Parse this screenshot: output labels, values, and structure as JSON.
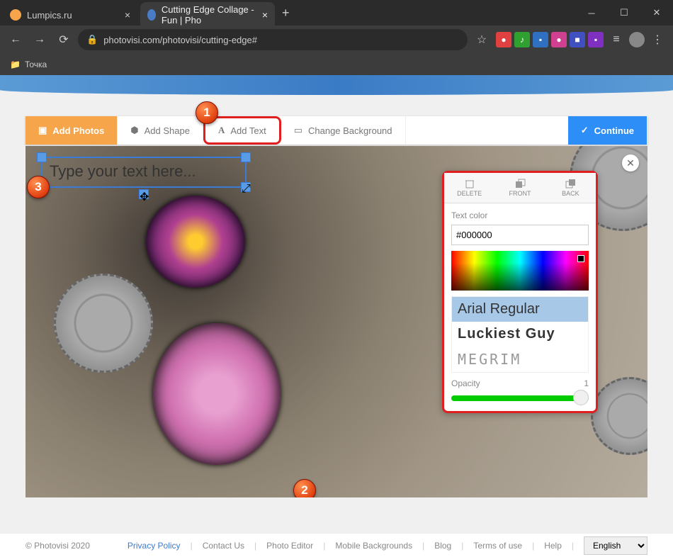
{
  "browser": {
    "tabs": [
      {
        "title": "Lumpics.ru",
        "active": false
      },
      {
        "title": "Cutting Edge Collage - Fun | Pho",
        "active": true
      }
    ],
    "url": "photovisi.com/photovisi/cutting-edge#",
    "bookmark": {
      "label": "Точка"
    }
  },
  "toolbar": {
    "add_photos": "Add Photos",
    "add_shape": "Add Shape",
    "add_text": "Add Text",
    "change_bg": "Change Background",
    "continue": "Continue"
  },
  "canvas": {
    "text_placeholder": "Type your text here..."
  },
  "panel": {
    "delete": "DELETE",
    "front": "FRONT",
    "back": "BACK",
    "text_color_label": "Text color",
    "color_value": "#000000",
    "fonts": [
      "Arial Regular",
      "Luckiest Guy",
      "MEGRIM"
    ],
    "opacity_label": "Opacity",
    "opacity_value": "1"
  },
  "footer": {
    "copyright": "© Photovisi 2020",
    "links": [
      "Privacy Policy",
      "Contact Us",
      "Photo Editor",
      "Mobile Backgrounds",
      "Blog",
      "Terms of use",
      "Help"
    ],
    "language": "English"
  },
  "badges": {
    "b1": "1",
    "b2": "2",
    "b3": "3"
  }
}
